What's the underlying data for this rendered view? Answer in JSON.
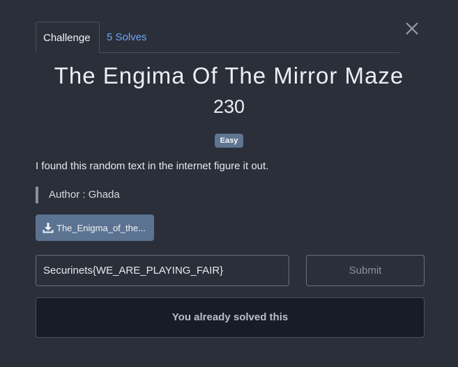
{
  "tabs": {
    "challenge_label": "Challenge",
    "solves_label": "5 Solves"
  },
  "challenge": {
    "name": "The Engima Of The Mirror Maze",
    "points": "230",
    "difficulty": "Easy",
    "description": "I found this random text in the internet figure it out.",
    "author": "Author : Ghada",
    "file_label": "The_Enigma_of_the..."
  },
  "flag_form": {
    "input_value": "Securinets{WE_ARE_PLAYING_FAIR}",
    "submit_label": "Submit"
  },
  "status": {
    "solved_message": "You already solved this"
  },
  "icons": {
    "close": "close-icon",
    "download": "download-icon"
  },
  "colors": {
    "background": "#2b2f39",
    "tab_link": "#6ea8f2",
    "badge": "#5f7591",
    "file_button": "#5b7391",
    "solved_box": "#171c27"
  }
}
